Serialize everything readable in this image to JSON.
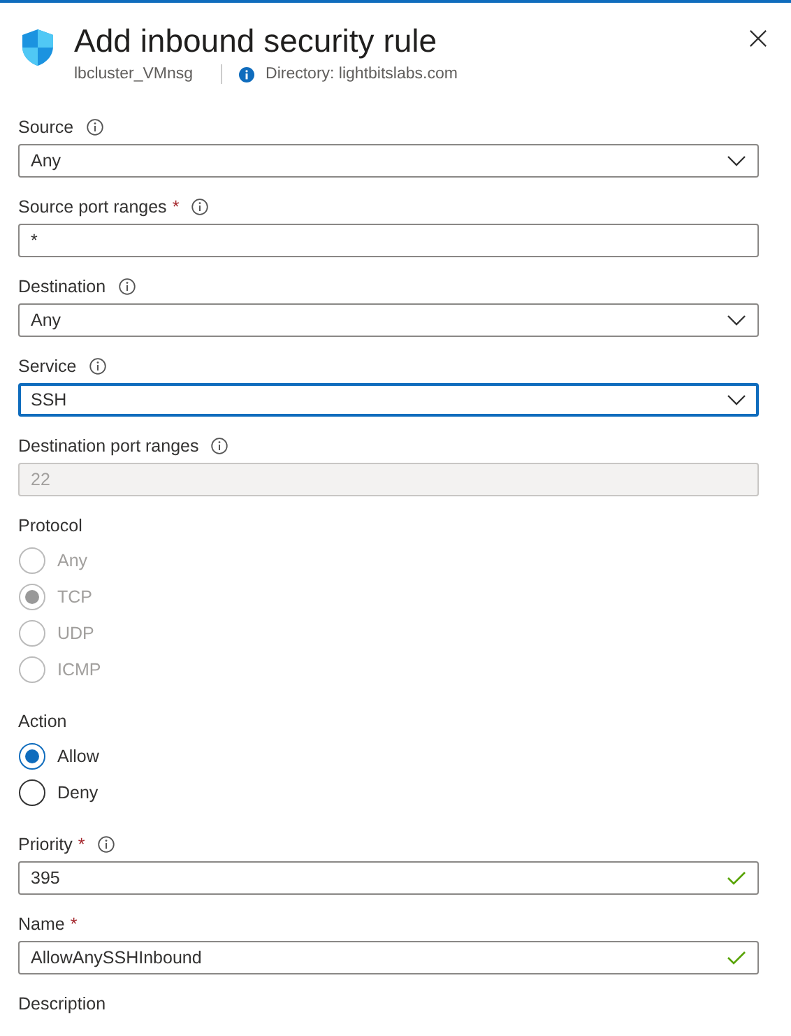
{
  "header": {
    "title": "Add inbound security rule",
    "resource": "lbcluster_VMnsg",
    "directory": "Directory: lightbitslabs.com"
  },
  "fields": [
    {
      "kind": "dropdown",
      "label": "Source",
      "info": true,
      "value": "Any",
      "focused": false
    },
    {
      "kind": "text",
      "label": "Source port ranges",
      "required": true,
      "info": true,
      "value": "*"
    },
    {
      "kind": "dropdown",
      "label": "Destination",
      "info": true,
      "value": "Any",
      "focused": false
    },
    {
      "kind": "dropdown",
      "label": "Service",
      "info": true,
      "value": "SSH",
      "focused": true
    },
    {
      "kind": "text",
      "label": "Destination port ranges",
      "info": true,
      "value": "22",
      "disabled": true
    },
    {
      "kind": "radio",
      "label": "Protocol",
      "disabled": true,
      "options": [
        {
          "label": "Any",
          "selected": false
        },
        {
          "label": "TCP",
          "selected": true
        },
        {
          "label": "UDP",
          "selected": false
        },
        {
          "label": "ICMP",
          "selected": false
        }
      ]
    },
    {
      "kind": "radio",
      "label": "Action",
      "disabled": false,
      "options": [
        {
          "label": "Allow",
          "selected": true
        },
        {
          "label": "Deny",
          "selected": false
        }
      ]
    },
    {
      "kind": "text",
      "label": "Priority",
      "required": true,
      "info": true,
      "value": "395",
      "valid": true
    },
    {
      "kind": "text",
      "label": "Name",
      "required": true,
      "value": "AllowAnySSHInbound",
      "valid": true
    },
    {
      "kind": "label",
      "label": "Description"
    }
  ]
}
